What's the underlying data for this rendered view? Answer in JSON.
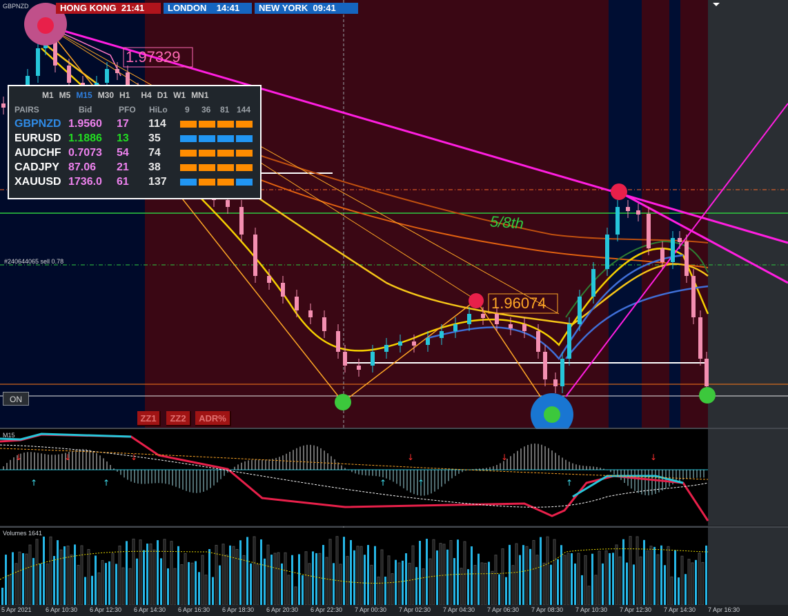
{
  "symbol": "GBPNZD",
  "clocks": [
    {
      "city": "HONG KONG",
      "time": "21:41"
    },
    {
      "city": "LONDON",
      "time": "14:41"
    },
    {
      "city": "NEW YORK",
      "time": "09:41"
    }
  ],
  "price_labels": {
    "high": "1.97329",
    "mid": "1.96074"
  },
  "annotation": "5/8th",
  "order_line": "#240644065 sell 0.78",
  "on_button": "ON",
  "zz_buttons": [
    "ZZ1",
    "ZZ2",
    "ADR%"
  ],
  "dashboard": {
    "timeframes": [
      "M1",
      "M5",
      "M15",
      "M30",
      "H1",
      "H4",
      "D1",
      "W1",
      "MN1"
    ],
    "active_timeframe": "M15",
    "headers": {
      "pairs": "PAIRS",
      "bid": "Bid",
      "pfo": "PFO",
      "hilo": "HiLo",
      "p9": "9",
      "p36": "36",
      "p81": "81",
      "p144": "144"
    },
    "rows": [
      {
        "pair": "GBPNZD",
        "bid": "1.9560",
        "pfo": "17",
        "hilo": "114",
        "pair_color": "#2f8be6",
        "bid_color": "#ee82ee",
        "boxes": [
          "#ff8c00",
          "#ff8c00",
          "#ff8c00",
          "#ff8c00"
        ]
      },
      {
        "pair": "EURUSD",
        "bid": "1.1886",
        "pfo": "13",
        "hilo": "35",
        "pair_color": "#ffffff",
        "bid_color": "#22dd22",
        "pfo_color": "#22dd22",
        "boxes": [
          "#2196f3",
          "#2196f3",
          "#2196f3",
          "#2196f3"
        ]
      },
      {
        "pair": "AUDCHF",
        "bid": "0.7073",
        "pfo": "54",
        "hilo": "74",
        "pair_color": "#ffffff",
        "bid_color": "#ee82ee",
        "boxes": [
          "#ff8c00",
          "#ff8c00",
          "#ff8c00",
          "#ff8c00"
        ]
      },
      {
        "pair": "CADJPY",
        "bid": "87.06",
        "pfo": "21",
        "hilo": "38",
        "pair_color": "#ffffff",
        "bid_color": "#ee82ee",
        "boxes": [
          "#ff8c00",
          "#ff8c00",
          "#ff8c00",
          "#ff8c00"
        ]
      },
      {
        "pair": "XAUUSD",
        "bid": "1736.0",
        "pfo": "61",
        "hilo": "137",
        "pair_color": "#ffffff",
        "bid_color": "#ee82ee",
        "boxes": [
          "#2196f3",
          "#ff8c00",
          "#ff8c00",
          "#2196f3"
        ]
      }
    ]
  },
  "panels": {
    "oscillator": "M15",
    "volumes": "Volumes 1641"
  },
  "x_labels": [
    "5 Apr 2021",
    "6 Apr 10:30",
    "6 Apr 12:30",
    "6 Apr 14:30",
    "6 Apr 16:30",
    "6 Apr 18:30",
    "6 Apr 20:30",
    "6 Apr 22:30",
    "7 Apr 00:30",
    "7 Apr 02:30",
    "7 Apr 04:30",
    "7 Apr 06:30",
    "7 Apr 08:30",
    "7 Apr 10:30",
    "7 Apr 12:30",
    "7 Apr 14:30",
    "7 Apr 16:30"
  ],
  "colors": {
    "background": "#000a2a",
    "bear_zone": "#3a0714",
    "bull_candle": "#26c6da",
    "bear_candle": "#f48fb1",
    "trend": "#ff1ee0",
    "zigzag": "#ffa726"
  }
}
